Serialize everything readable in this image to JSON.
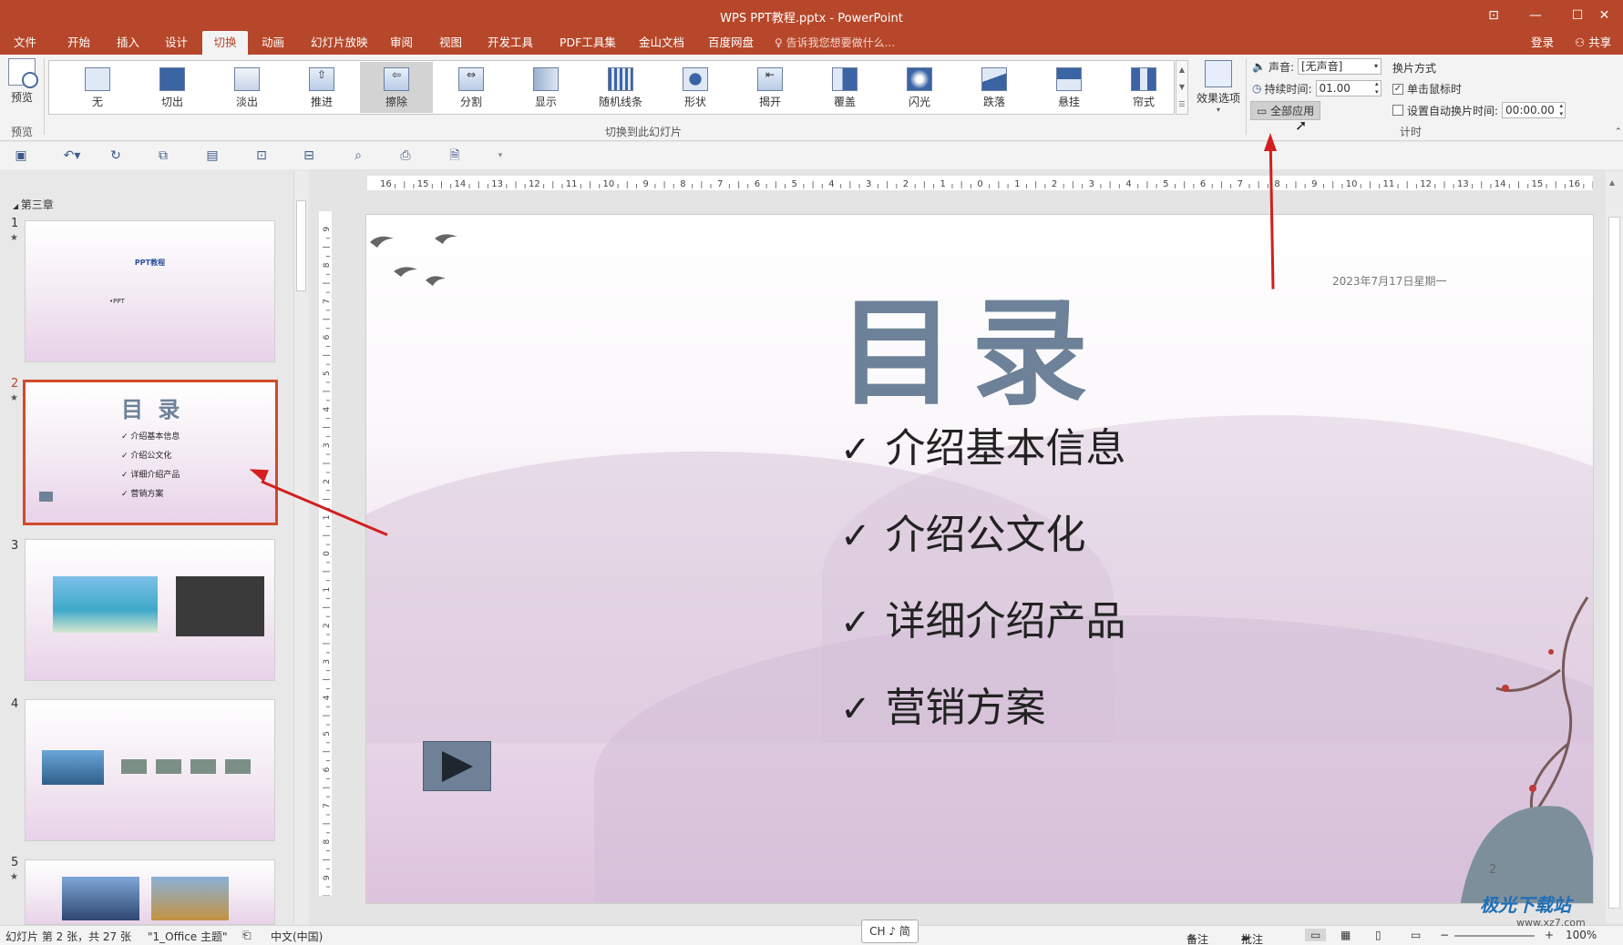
{
  "window": {
    "title": "WPS PPT教程.pptx - PowerPoint",
    "controls": [
      "restore-ribbon",
      "minimize",
      "maximize",
      "close"
    ]
  },
  "menu_tabs": [
    "文件",
    "开始",
    "插入",
    "设计",
    "切换",
    "动画",
    "幻灯片放映",
    "审阅",
    "视图",
    "开发工具",
    "PDF工具集",
    "金山文档",
    "百度网盘"
  ],
  "active_tab": "切换",
  "tell_me": "告诉我您想要做什么...",
  "account": {
    "login": "登录",
    "share": "共享"
  },
  "ribbon": {
    "preview_label": "预览",
    "preview_group": "预览",
    "transitions_group": "切换到此幻灯片",
    "transitions": [
      "无",
      "切出",
      "淡出",
      "推进",
      "擦除",
      "分割",
      "显示",
      "随机线条",
      "形状",
      "揭开",
      "覆盖",
      "闪光",
      "跌落",
      "悬挂",
      "帘式"
    ],
    "selected_transition": "擦除",
    "effect_options": "效果选项",
    "timing_group": "计时",
    "sound_label": "声音:",
    "sound_value": "[无声音]",
    "duration_label": "持续时间:",
    "duration_value": "01.00",
    "apply_all": "全部应用",
    "advance_title": "换片方式",
    "on_click": "单击鼠标时",
    "on_click_checked": true,
    "auto_after": "设置自动换片时间:",
    "auto_after_checked": false,
    "auto_after_value": "00:00.00"
  },
  "thumbnails": {
    "section": "第三章",
    "slides": [
      {
        "num": "1",
        "title": "PPT教程",
        "sub": "•PPT"
      },
      {
        "num": "2",
        "title": "目 录",
        "items": [
          "介绍基本信息",
          "介绍公文化",
          "详细介绍产品",
          "营销方案"
        ]
      },
      {
        "num": "3"
      },
      {
        "num": "4"
      },
      {
        "num": "5"
      }
    ],
    "selected": "2"
  },
  "slide": {
    "title": "目录",
    "date": "2023年7月17日星期一",
    "bullets": [
      "介绍基本信息",
      "介绍公文化",
      "详细介绍产品",
      "营销方案"
    ],
    "page_number": "2"
  },
  "ruler": {
    "h_ticks": [
      "16",
      "15",
      "14",
      "13",
      "12",
      "11",
      "10",
      "9",
      "8",
      "7",
      "6",
      "5",
      "4",
      "3",
      "2",
      "1",
      "0",
      "1",
      "2",
      "3",
      "4",
      "5",
      "6",
      "7",
      "8",
      "9",
      "10",
      "11",
      "12",
      "13",
      "14",
      "15",
      "16"
    ],
    "v_ticks": [
      "9",
      "8",
      "7",
      "6",
      "5",
      "4",
      "3",
      "2",
      "1",
      "0",
      "1",
      "2",
      "3",
      "4",
      "5",
      "6",
      "7",
      "8",
      "9"
    ]
  },
  "status": {
    "slide_info": "幻灯片 第 2 张，共 27 张",
    "theme": "\"1_Office 主题\"",
    "language": "中文(中国)",
    "ime": "CH ♪ 简",
    "notes": "备注",
    "comments": "批注",
    "zoom": "100%"
  },
  "watermark": {
    "name": "极光下载站",
    "url": "www.xz7.com"
  },
  "colors": {
    "accent": "#b7472a",
    "annotation": "#d21f1f",
    "slide_title": "#6d8298"
  }
}
